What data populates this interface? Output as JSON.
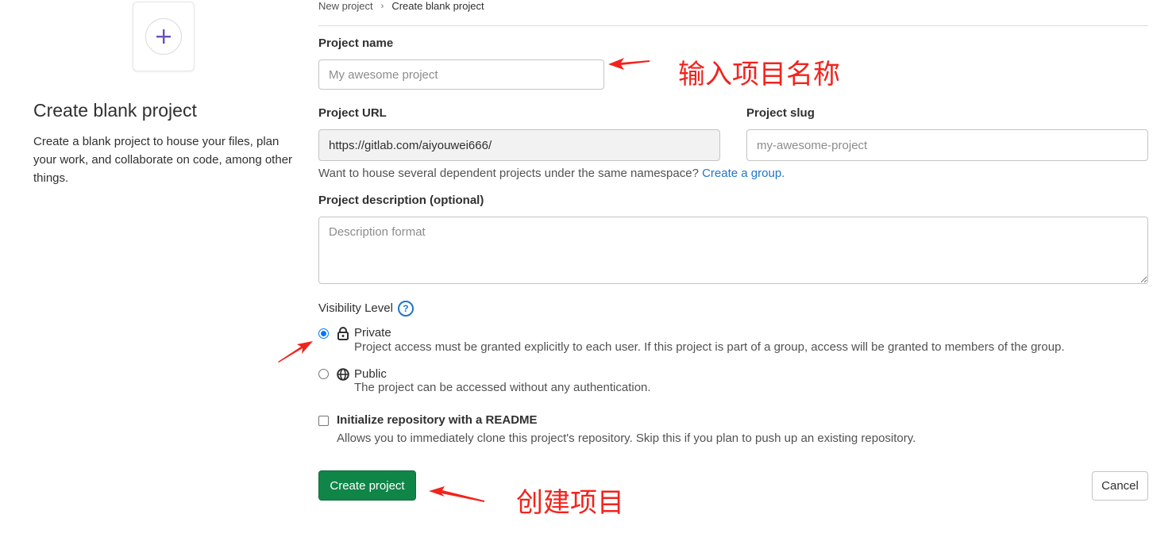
{
  "left_panel": {
    "icon": "plus-icon",
    "title": "Create blank project",
    "description": "Create a blank project to house your files, plan your work, and collaborate on code, among other things."
  },
  "breadcrumb": {
    "parent": "New project",
    "current": "Create blank project"
  },
  "form": {
    "project_name": {
      "label": "Project name",
      "placeholder": "My awesome project",
      "value": ""
    },
    "project_url": {
      "label": "Project URL",
      "value": "https://gitlab.com/aiyouwei666/"
    },
    "project_slug": {
      "label": "Project slug",
      "placeholder": "my-awesome-project",
      "value": ""
    },
    "namespace_help": {
      "text": "Want to house several dependent projects under the same namespace?",
      "link": "Create a group."
    },
    "description": {
      "label": "Project description (optional)",
      "placeholder": "Description format"
    },
    "visibility": {
      "label": "Visibility Level",
      "help_icon": "question-circle-icon",
      "options": [
        {
          "title": "Private",
          "icon": "lock-icon",
          "description": "Project access must be granted explicitly to each user. If this project is part of a group, access will be granted to members of the group.",
          "checked": true
        },
        {
          "title": "Public",
          "icon": "globe-icon",
          "description": "The project can be accessed without any authentication.",
          "checked": false
        }
      ]
    },
    "readme": {
      "label": "Initialize repository with a README",
      "description": "Allows you to immediately clone this project's repository. Skip this if you plan to push up an existing repository.",
      "checked": false
    },
    "create_button": "Create project",
    "cancel_button": "Cancel"
  },
  "annotations": {
    "name_hint": "输入项目名称",
    "create_hint": "创建项目",
    "color": "#f2231d"
  },
  "colors": {
    "primary": "#108548",
    "link": "#1f75cb",
    "radio_checked": "#0075ff"
  }
}
